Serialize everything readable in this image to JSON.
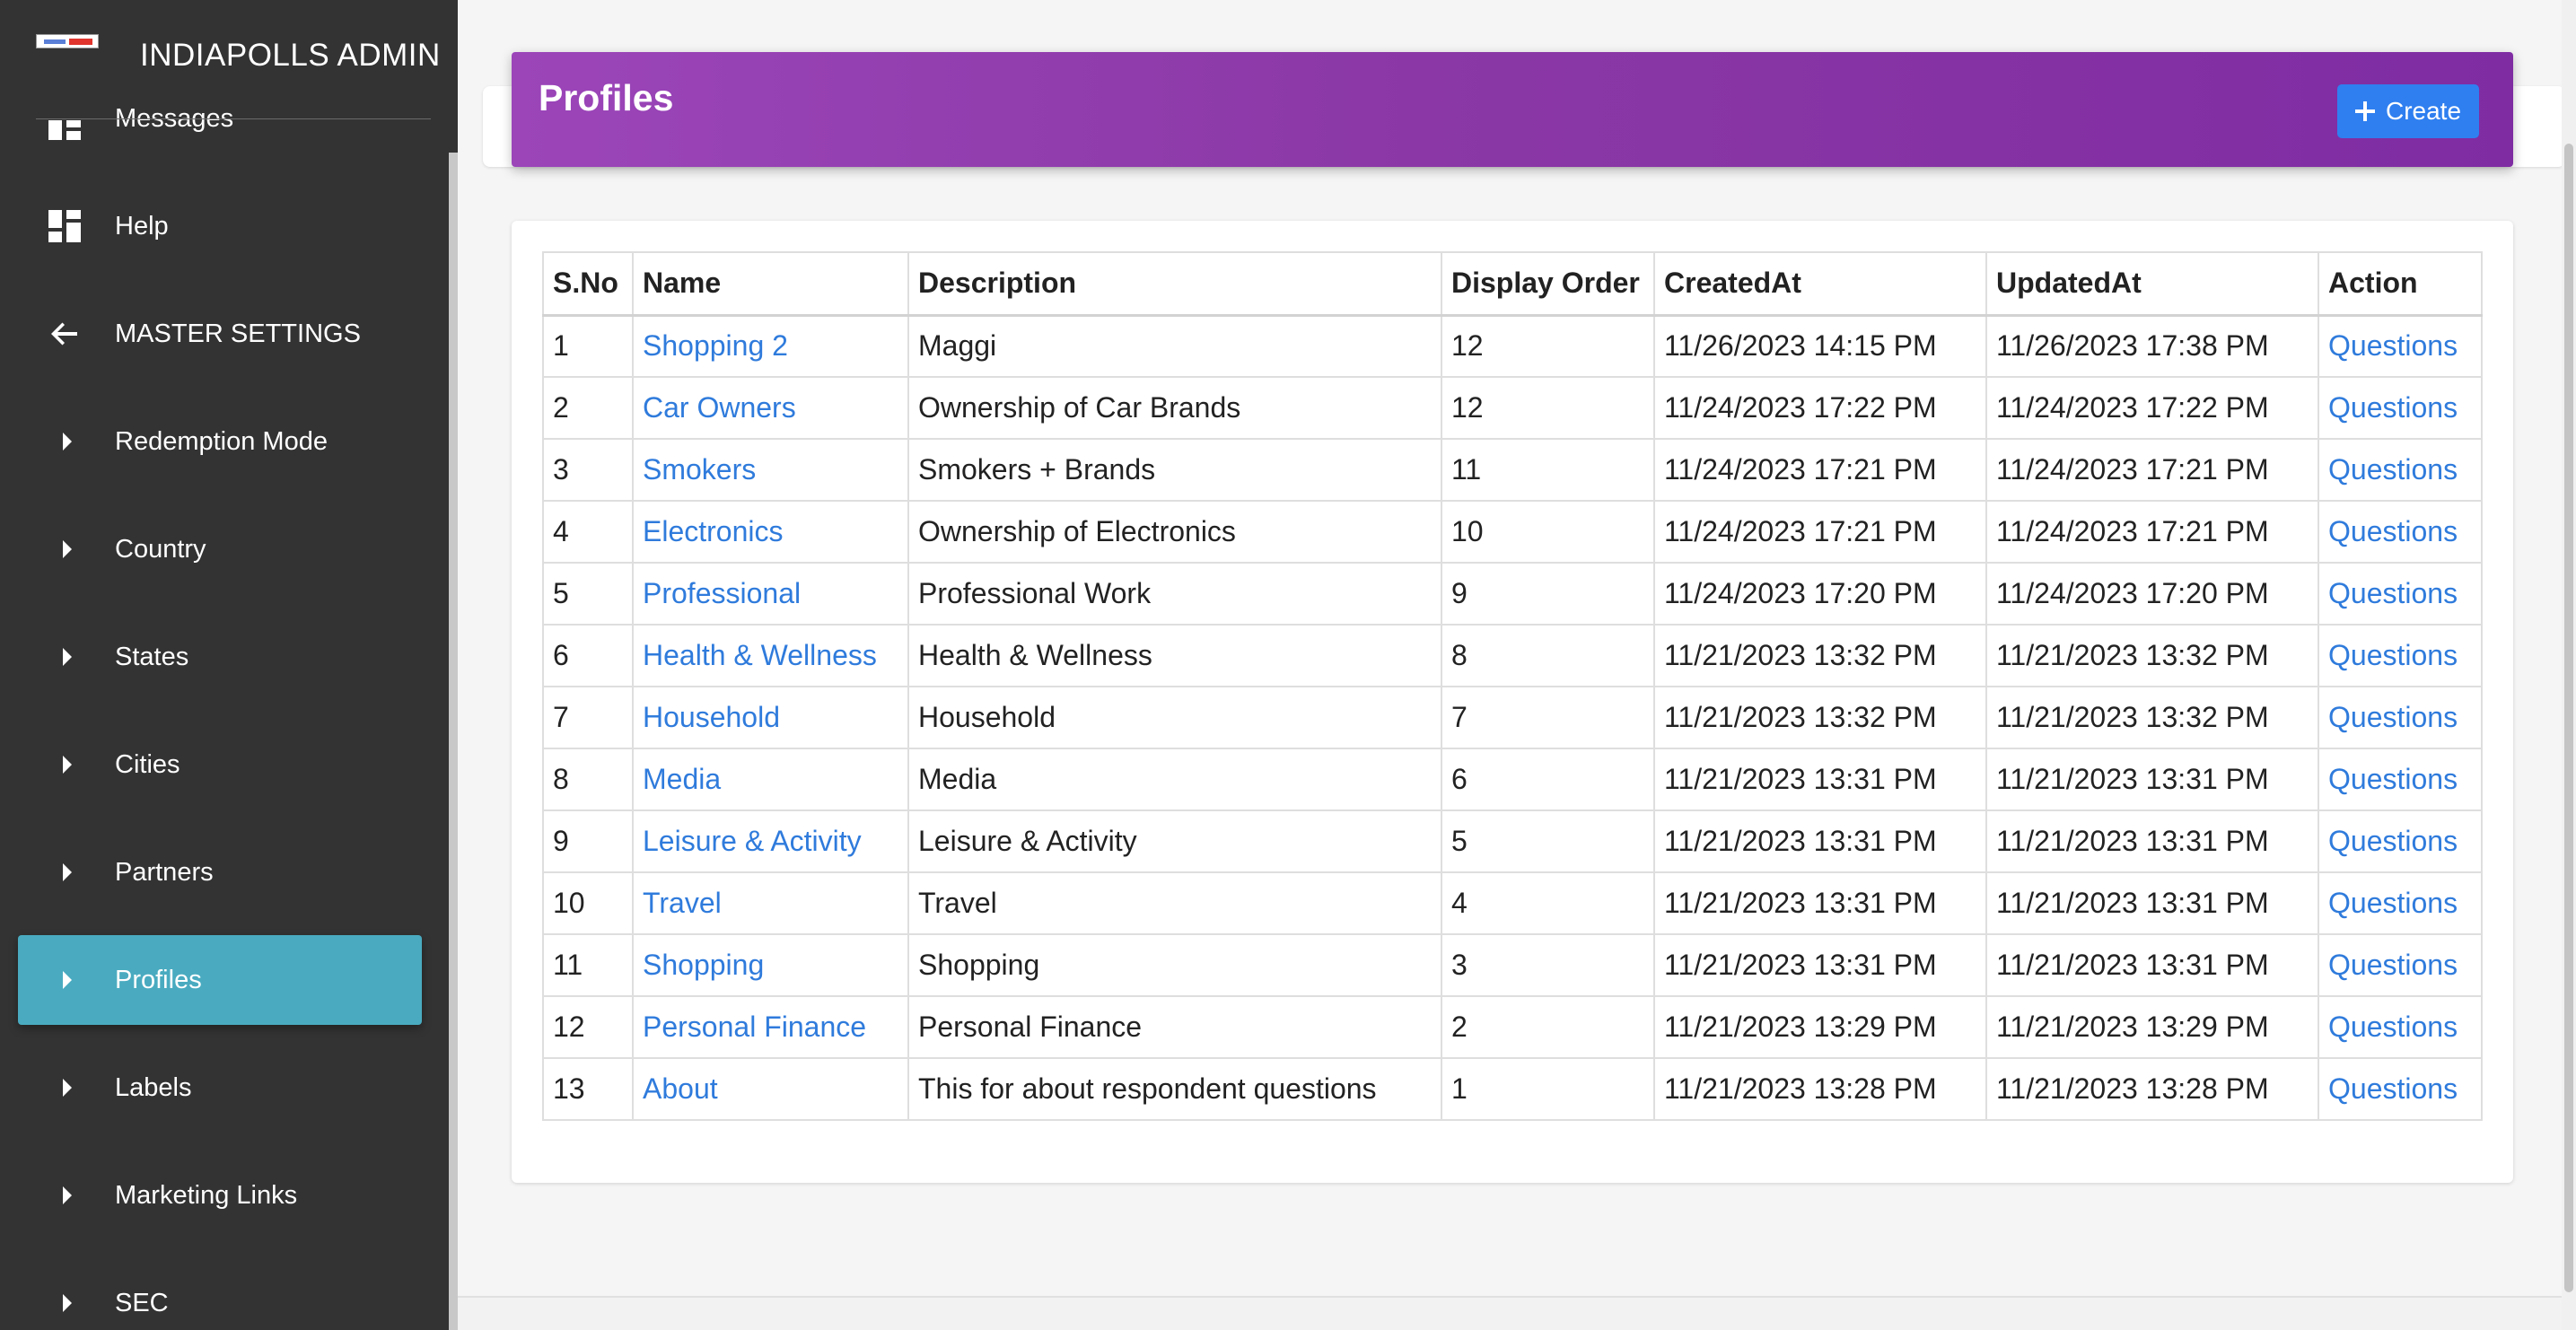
{
  "brand": {
    "title": "INDIAPOLLS ADMIN"
  },
  "sidebar": {
    "items": [
      {
        "label": "Messages",
        "icon": "dashboard-icon"
      },
      {
        "label": "Help",
        "icon": "dashboard-icon"
      },
      {
        "label": "MASTER SETTINGS",
        "icon": "arrow-left-icon"
      },
      {
        "label": "Redemption Mode",
        "icon": "caret-right-icon"
      },
      {
        "label": "Country",
        "icon": "caret-right-icon"
      },
      {
        "label": "States",
        "icon": "caret-right-icon"
      },
      {
        "label": "Cities",
        "icon": "caret-right-icon"
      },
      {
        "label": "Partners",
        "icon": "caret-right-icon"
      },
      {
        "label": "Profiles",
        "icon": "caret-right-icon",
        "active": true
      },
      {
        "label": "Labels",
        "icon": "caret-right-icon"
      },
      {
        "label": "Marketing Links",
        "icon": "caret-right-icon"
      },
      {
        "label": "SEC",
        "icon": "caret-right-icon"
      }
    ]
  },
  "header": {
    "title": "Profiles",
    "create_label": "Create"
  },
  "table": {
    "columns": [
      "S.No",
      "Name",
      "Description",
      "Display Order",
      "CreatedAt",
      "UpdatedAt",
      "Action"
    ],
    "rows": [
      [
        "1",
        "Shopping 2",
        "Maggi",
        "12",
        "11/26/2023 14:15 PM",
        "11/26/2023 17:38 PM",
        "Questions"
      ],
      [
        "2",
        "Car Owners",
        "Ownership of Car Brands",
        "12",
        "11/24/2023 17:22 PM",
        "11/24/2023 17:22 PM",
        "Questions"
      ],
      [
        "3",
        "Smokers",
        "Smokers + Brands",
        "11",
        "11/24/2023 17:21 PM",
        "11/24/2023 17:21 PM",
        "Questions"
      ],
      [
        "4",
        "Electronics",
        "Ownership of Electronics",
        "10",
        "11/24/2023 17:21 PM",
        "11/24/2023 17:21 PM",
        "Questions"
      ],
      [
        "5",
        "Professional",
        "Professional Work",
        "9",
        "11/24/2023 17:20 PM",
        "11/24/2023 17:20 PM",
        "Questions"
      ],
      [
        "6",
        "Health & Wellness",
        "Health & Wellness",
        "8",
        "11/21/2023 13:32 PM",
        "11/21/2023 13:32 PM",
        "Questions"
      ],
      [
        "7",
        "Household",
        "Household",
        "7",
        "11/21/2023 13:32 PM",
        "11/21/2023 13:32 PM",
        "Questions"
      ],
      [
        "8",
        "Media",
        "Media",
        "6",
        "11/21/2023 13:31 PM",
        "11/21/2023 13:31 PM",
        "Questions"
      ],
      [
        "9",
        "Leisure & Activity",
        "Leisure & Activity",
        "5",
        "11/21/2023 13:31 PM",
        "11/21/2023 13:31 PM",
        "Questions"
      ],
      [
        "10",
        "Travel",
        "Travel",
        "4",
        "11/21/2023 13:31 PM",
        "11/21/2023 13:31 PM",
        "Questions"
      ],
      [
        "11",
        "Shopping",
        "Shopping",
        "3",
        "11/21/2023 13:31 PM",
        "11/21/2023 13:31 PM",
        "Questions"
      ],
      [
        "12",
        "Personal Finance",
        "Personal Finance",
        "2",
        "11/21/2023 13:29 PM",
        "11/21/2023 13:29 PM",
        "Questions"
      ],
      [
        "13",
        "About",
        "This for about respondent questions",
        "1",
        "11/21/2023 13:28 PM",
        "11/21/2023 13:28 PM",
        "Questions"
      ]
    ]
  },
  "colors": {
    "sidebar_bg": "#333333",
    "active_item": "#4aabc0",
    "header_gradient_start": "#9b45b9",
    "header_gradient_end": "#7f2ca3",
    "primary_button": "#2f7ff0",
    "link": "#2f7bdc"
  }
}
